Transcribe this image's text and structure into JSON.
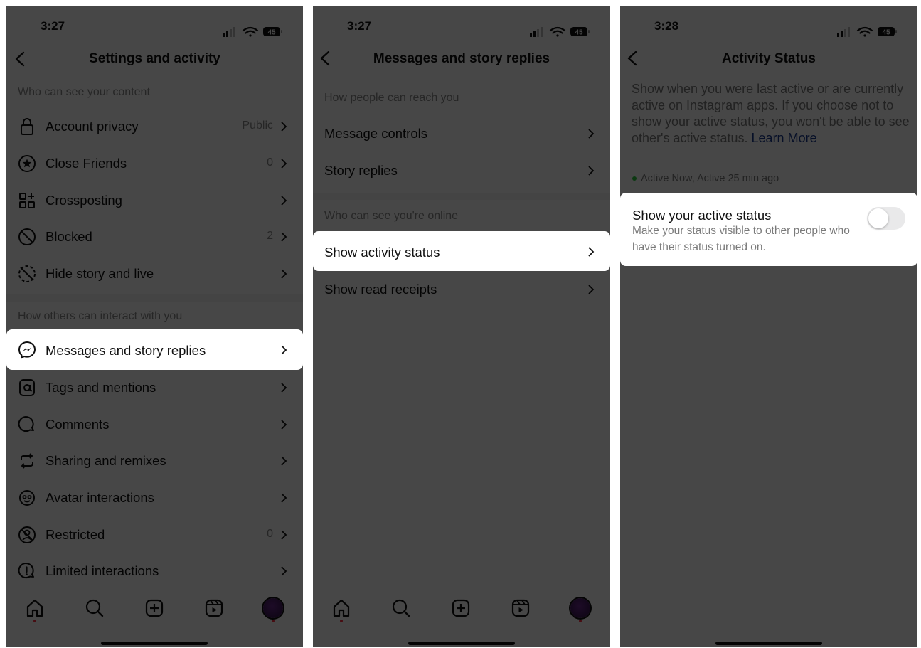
{
  "status_bar": {
    "battery": "45"
  },
  "screen1": {
    "time": "3:27",
    "title": "Settings and activity",
    "section_content": "Who can see your content",
    "items_top": [
      {
        "label": "Account privacy",
        "value": "Public",
        "icon": "lock-icon"
      },
      {
        "label": "Close Friends",
        "value": "0",
        "icon": "star-circle-icon"
      },
      {
        "label": "Crossposting",
        "value": "",
        "icon": "crosspost-grid-icon"
      },
      {
        "label": "Blocked",
        "value": "2",
        "icon": "blocked-icon"
      },
      {
        "label": "Hide story and live",
        "value": "",
        "icon": "hide-story-icon"
      }
    ],
    "section_interact": "How others can interact with you",
    "highlight_item": {
      "label": "Messages and story replies",
      "icon": "messenger-icon"
    },
    "items_bottom": [
      {
        "label": "Tags and mentions",
        "value": "",
        "icon": "at-sign-icon"
      },
      {
        "label": "Comments",
        "value": "",
        "icon": "comment-icon"
      },
      {
        "label": "Sharing and remixes",
        "value": "",
        "icon": "remix-icon"
      },
      {
        "label": "Avatar interactions",
        "value": "",
        "icon": "avatar-icon"
      },
      {
        "label": "Restricted",
        "value": "0",
        "icon": "restricted-icon"
      },
      {
        "label": "Limited interactions",
        "value": "",
        "icon": "limited-icon"
      }
    ]
  },
  "screen2": {
    "time": "3:27",
    "title": "Messages and story replies",
    "section_reach": "How people can reach you",
    "items_reach": [
      {
        "label": "Message controls"
      },
      {
        "label": "Story replies"
      }
    ],
    "section_online": "Who can see you're online",
    "highlight_item": {
      "label": "Show activity status"
    },
    "items_online": [
      {
        "label": "Show read receipts"
      }
    ]
  },
  "screen3": {
    "time": "3:28",
    "title": "Activity Status",
    "description": "Show when you were last active or are currently active on Instagram apps. If you choose not to show your active status, you won't be able to see other's active status.",
    "learn_more": "Learn More",
    "active_note": "Active Now, Active 25 min ago",
    "setting_title": "Show your active status",
    "setting_desc": "Make your status visible to other people who have their status turned on.",
    "toggle_on": false
  },
  "colors": {
    "overlay": "#4a4a4a",
    "active_dot": "#2ecc40",
    "link": "#1a3b8f",
    "nav_dot": "#ff3040"
  }
}
